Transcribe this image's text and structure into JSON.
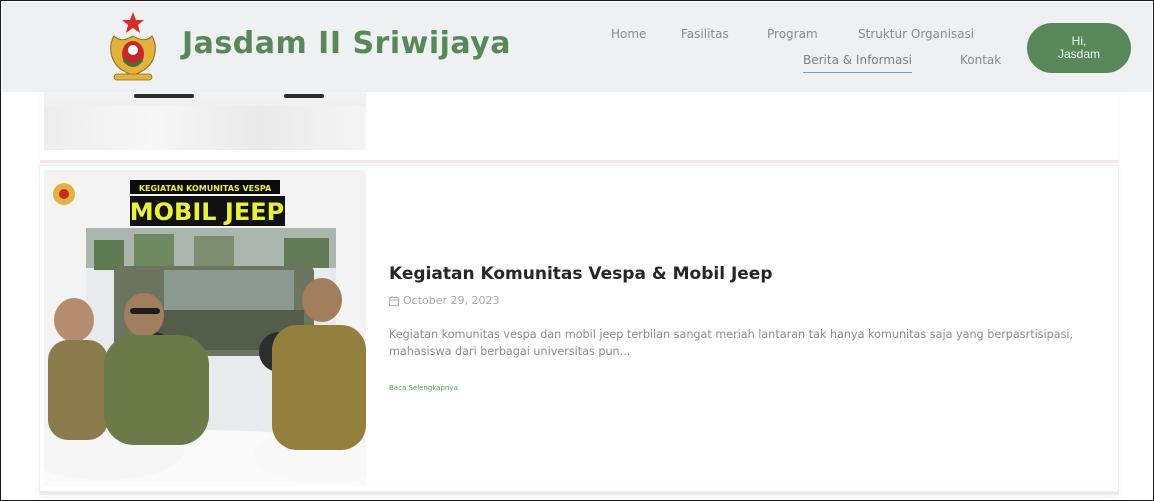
{
  "brand": {
    "name": "Jasdam II Sriwijaya",
    "logo_icon": "military-emblem-icon"
  },
  "nav": {
    "home": "Home",
    "fasilitas": "Fasilitas",
    "program": "Program",
    "struktur": "Struktur Organisasi",
    "berita": "Berita & Informasi",
    "kontak": "Kontak"
  },
  "user_button": {
    "line1": "Hi,",
    "line2": "Jasdam"
  },
  "article": {
    "image_heading_small": "KEGIATAN KOMUNITAS VESPA",
    "image_heading_big": "MOBIL JEEP",
    "title": "Kegiatan Komunitas Vespa & Mobil Jeep",
    "date": "October 29, 2023",
    "excerpt": "Kegiatan komunitas vespa dan mobil jeep terbilan sangat meriah lantaran tak hanya komunitas saja yang berpasrtisipasi, mahasiswa dari berbagai universitas pun...",
    "read_more": "Baca Selengkapnya"
  },
  "colors": {
    "brand_green": "#58885a",
    "header_bg": "#eef0f1",
    "link_green": "#4ea35a"
  }
}
